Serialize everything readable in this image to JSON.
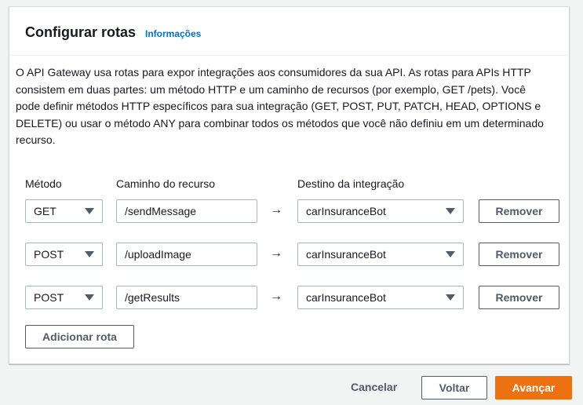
{
  "panel": {
    "title": "Configurar rotas",
    "info_link": "Informações",
    "description": "O API Gateway usa rotas para expor integrações aos consumidores da sua API. As rotas para APIs HTTP consistem em duas partes: um método HTTP e um caminho de recursos (por exemplo, GET /pets). Você pode definir métodos HTTP específicos para sua integração (GET, POST, PUT, PATCH, HEAD, OPTIONS e DELETE) ou usar o método ANY para combinar todos os métodos que você não definiu em um determinado recurso."
  },
  "columns": {
    "method": "Método",
    "path": "Caminho do recurso",
    "target": "Destino da integração"
  },
  "routes": [
    {
      "method": "GET",
      "path": "/sendMessage",
      "arrow": "→",
      "target": "carInsuranceBot",
      "remove_label": "Remover"
    },
    {
      "method": "POST",
      "path": "/uploadImage",
      "arrow": "→",
      "target": "carInsuranceBot",
      "remove_label": "Remover"
    },
    {
      "method": "POST",
      "path": "/getResults",
      "arrow": "→",
      "target": "carInsuranceBot",
      "remove_label": "Remover"
    }
  ],
  "add_route_label": "Adicionar rota",
  "footer": {
    "cancel": "Cancelar",
    "back": "Voltar",
    "next": "Avançar"
  },
  "colors": {
    "primary": "#ec7211",
    "link": "#0073bb"
  }
}
